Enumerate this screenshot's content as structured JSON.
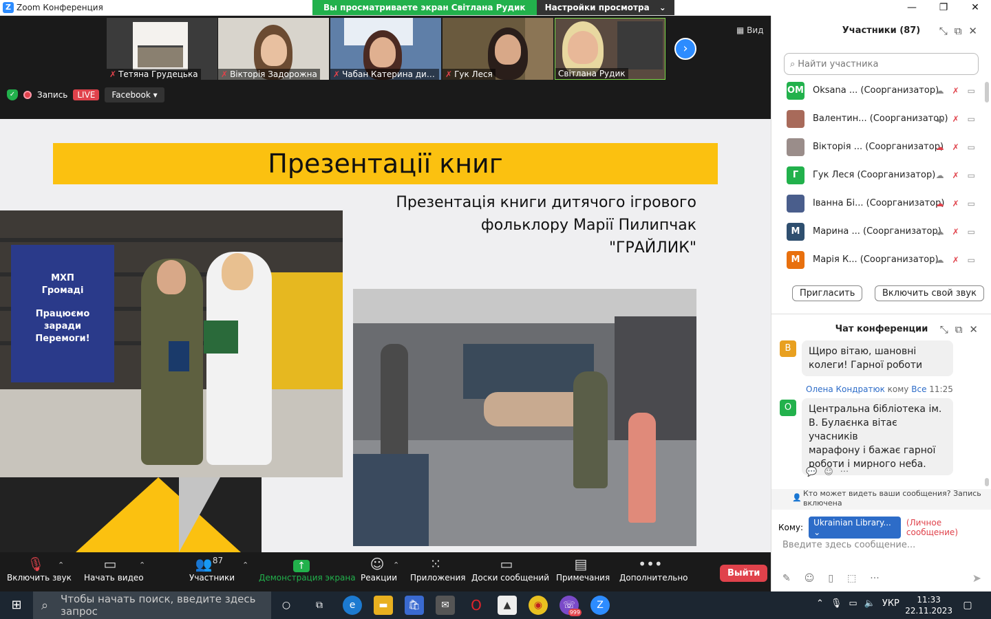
{
  "window": {
    "title": "Zoom Конференция",
    "logo_letter": "Z",
    "share_banner": "Вы просматриваете экран Світлана Рудик",
    "view_settings": "Настройки просмотра",
    "controls": [
      "—",
      "❐",
      "✕"
    ]
  },
  "video_strip": {
    "tiles": [
      {
        "label": "Тетяна Грудецька",
        "muted": true
      },
      {
        "label": "Вікторія Задорожна",
        "muted": true
      },
      {
        "label": "Чабан Катерина дир...",
        "muted": true
      },
      {
        "label": "Гук Леся",
        "muted": true
      },
      {
        "label": "Світлана Рудик",
        "muted": false
      }
    ],
    "view_label": "Вид",
    "recording_label": "Запись",
    "live_label": "LIVE",
    "stream_target": "Facebook"
  },
  "slide": {
    "title": "Презентації книг",
    "subtitle_lines": [
      "Презентація книги дитячого ігрового",
      "фольклору Марії Пилипчак",
      "\"ГРАЙЛИК\""
    ],
    "banner_text": [
      "МХП",
      "Громаді",
      "Працюємо",
      "заради",
      "Перемоги!"
    ]
  },
  "toolbar": {
    "buttons": [
      {
        "label": "Включить звук",
        "icon": "mic-muted-icon"
      },
      {
        "label": "Начать видео",
        "icon": "video-off-icon"
      },
      {
        "label": "Участники",
        "icon": "participants-icon",
        "count": "87"
      },
      {
        "label": "Демонстрация экрана",
        "icon": "share-screen-icon"
      },
      {
        "label": "Реакции",
        "icon": "reactions-icon"
      },
      {
        "label": "Приложения",
        "icon": "apps-icon"
      },
      {
        "label": "Доски сообщений",
        "icon": "whiteboard-icon"
      },
      {
        "label": "Примечания",
        "icon": "notes-icon"
      },
      {
        "label": "Дополнительно",
        "icon": "more-icon"
      }
    ],
    "leave_label": "Выйти",
    "accent_green": "#22b14c"
  },
  "participants": {
    "header": "Участники (87)",
    "search_placeholder": "Найти участника",
    "rows": [
      {
        "initials": "ОМ",
        "name": "Oksana ... (Соорганизатор)",
        "color": "#22b14c"
      },
      {
        "initials": "",
        "name": "Валентин... (Соорганизатор)",
        "color": "#a86a5a"
      },
      {
        "initials": "",
        "name": "Вікторія ... (Соорганизатор)",
        "color": "#9a8d8a"
      },
      {
        "initials": "Г",
        "name": "Гук Леся (Соорганизатор)",
        "color": "#22b14c"
      },
      {
        "initials": "",
        "name": "Іванна Бі... (Соорганизатор)",
        "color": "#4a5e8c"
      },
      {
        "initials": "М",
        "name": "Марина ... (Соорганизатор)",
        "color": "#2f4f6f"
      },
      {
        "initials": "М",
        "name": "Марія К... (Соорганизатор)",
        "color": "#e8700e"
      }
    ],
    "invite_label": "Пригласить",
    "unmute_label": "Включить свой звук"
  },
  "chat": {
    "header": "Чат конференции",
    "messages": [
      {
        "avatar": "В",
        "avatar_color": "#e8a020",
        "text_lines": [
          "Щиро вітаю, шановні",
          "колеги! Гарної роботи"
        ]
      },
      {
        "avatar": "О",
        "avatar_color": "#22b14c",
        "sender": "Олена Кондратюк",
        "to_word": "кому",
        "to": "Все",
        "time": "11:25",
        "text_lines": [
          "Центральна  бібліотека ім.",
          "В. Булаєнка  вітає учасників",
          "марафону і бажає гарної",
          "роботи і мирного неба."
        ]
      }
    ],
    "visibility_note": "Кто может видеть ваши сообщения? Запись включена",
    "to_label": "Кому:",
    "to_value": "Ukrainian Library...",
    "private_label": "(Личное сообщение)",
    "input_placeholder": "Введите здесь сообщение..."
  },
  "taskbar": {
    "search_placeholder": "Чтобы начать поиск, введите здесь запрос",
    "language": "УКР",
    "time": "11:33",
    "date": "22.11.2023",
    "badge": "999"
  }
}
